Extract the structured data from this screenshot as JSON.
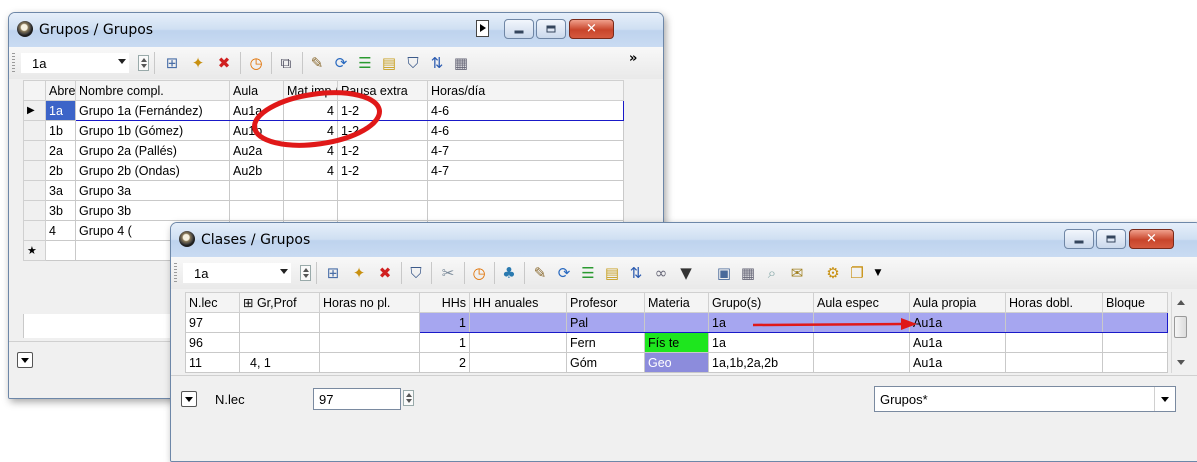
{
  "grupos": {
    "title": "Grupos / Grupos",
    "combo_value": "1a",
    "headers": [
      "Abrev",
      "Nombre compl.",
      "Aula",
      "Mat.imp./día",
      "Pausa extra",
      "Horas/día"
    ],
    "rows": [
      [
        "1a",
        "Grupo 1a (Fernández)",
        "Au1a",
        "4",
        "1-2",
        "4-6"
      ],
      [
        "1b",
        "Grupo 1b (Gómez)",
        "Au1b",
        "4",
        "1-2",
        "4-6"
      ],
      [
        "2a",
        "Grupo 2a (Pallés)",
        "Au2a",
        "4",
        "1-2",
        "4-7"
      ],
      [
        "2b",
        "Grupo 2b (Ondas)",
        "Au2b",
        "4",
        "1-2",
        "4-7"
      ],
      [
        "3a",
        "Grupo 3a",
        "",
        "",
        "",
        ""
      ],
      [
        "3b",
        "Grupo 3b",
        "",
        "",
        "",
        ""
      ],
      [
        "4",
        "Grupo 4 (",
        "",
        "",
        "",
        ""
      ]
    ],
    "current_row_marker": "▶",
    "new_row_marker": "★",
    "more_label": "»"
  },
  "clases": {
    "title": "Clases / Grupos",
    "combo_value": "1a",
    "headers": [
      "N.lec",
      "⊞ Gr,Prof",
      "Horas no pl.",
      "HHs",
      "HH anuales",
      "Profesor",
      "Materia",
      "Grupo(s)",
      "Aula espec",
      "Aula propia",
      "Horas dobl.",
      "Bloque"
    ],
    "rows": [
      [
        "97",
        "",
        "",
        "1",
        "",
        "Pal",
        "",
        "1a",
        "",
        "Au1a",
        "",
        ""
      ],
      [
        "96",
        "",
        "",
        "1",
        "",
        "Fern",
        "Fís te",
        "1a",
        "",
        "Au1a",
        "",
        ""
      ],
      [
        "11",
        "4, 1",
        "",
        "2",
        "",
        "Góm",
        "Geo",
        "1a,1b,2a,2b",
        "",
        "Au1a",
        "",
        ""
      ]
    ],
    "bottom_label": "N.lec",
    "bottom_value": "97",
    "view_select": "Grupos*"
  },
  "colors": {
    "selection_blue": "#a6a6f0",
    "selection_border": "#1919c8",
    "fis_te_green": "#1ee61e",
    "geo_purple": "#8c8cdc",
    "annotation_red": "#e01818"
  }
}
